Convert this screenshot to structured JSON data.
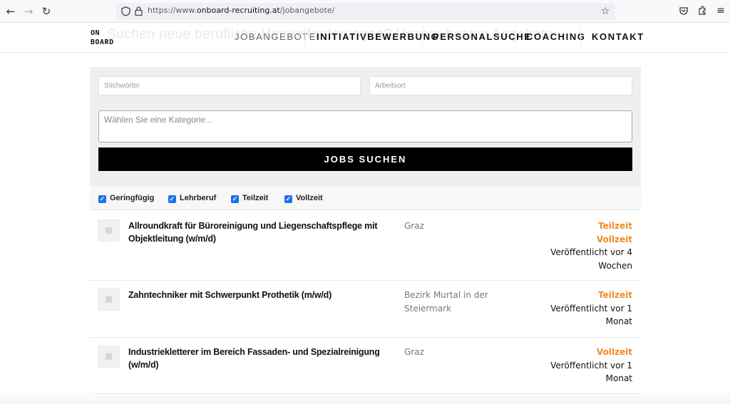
{
  "browser": {
    "url_prefix": "https://www.",
    "url_domain": "onboard-recruiting.at",
    "url_path": "/jobangebote/"
  },
  "header": {
    "ghost_text": "Suchen neue berufliche Herausforderungen? Unsere besten Angebote",
    "logo_line1": "ON",
    "logo_line2": "BOARD",
    "nav": [
      "JOBANGEBOTE",
      "INITIATIVBEWERBUNG",
      "PERSONALSUCHE",
      "COACHING",
      "KONTAKT"
    ]
  },
  "search": {
    "keywords_placeholder": "Stichwörter",
    "location_placeholder": "Arbeitsort",
    "category_placeholder": "Wählen Sie eine Kategorie...",
    "button_label": "JOBS SUCHEN"
  },
  "filters": [
    "Geringfügig",
    "Lehrberuf",
    "Teilzeit",
    "Vollzeit"
  ],
  "jobs": [
    {
      "title": "Allroundkraft für Büroreinigung und Liegenschaftspflege mit Objektleitung (w/m/d)",
      "location": "Graz",
      "tags": [
        "Teilzeit",
        "Vollzeit"
      ],
      "published": "Veröffentlicht vor 4 Wochen"
    },
    {
      "title": "Zahntechniker mit Schwerpunkt Prothetik (m/w/d)",
      "location": "Bezirk Murtal in der Steiermark",
      "tags": [
        "Teilzeit"
      ],
      "published": "Veröffentlicht vor 1 Monat"
    },
    {
      "title": "Industriekletterer im Bereich Fassaden- und Spezialreinigung (w/m/d)",
      "location": "Graz",
      "tags": [
        "Vollzeit"
      ],
      "published": "Veröffentlicht vor 1 Monat"
    }
  ],
  "colors": {
    "accent": "#f08a24",
    "checkbox": "#1a73e8",
    "button": "#000000",
    "panel": "#efefef"
  }
}
